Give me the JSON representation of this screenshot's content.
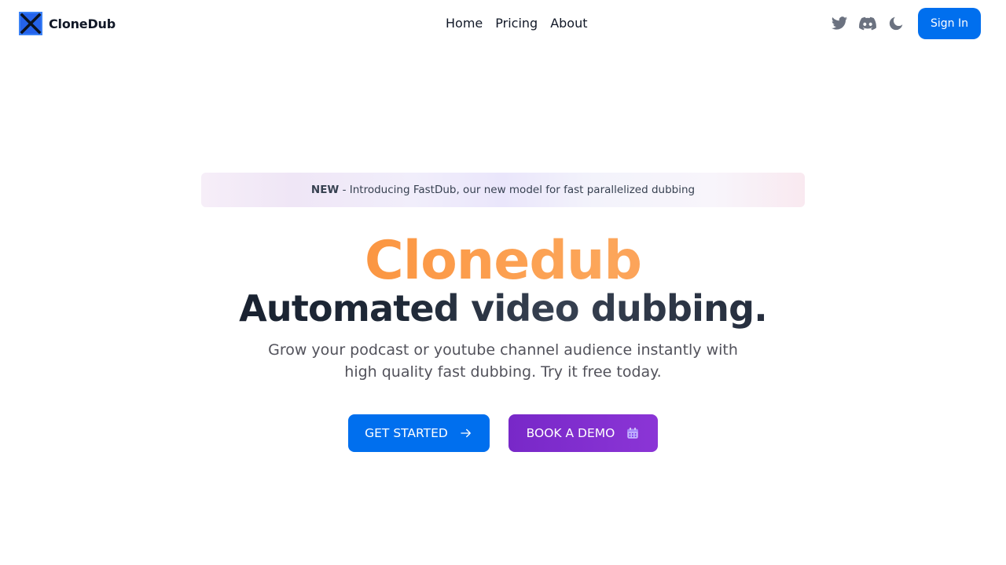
{
  "nav": {
    "brand": "CloneDub",
    "links": [
      "Home",
      "Pricing",
      "About"
    ],
    "icons": [
      "twitter-icon",
      "discord-icon",
      "moon-icon"
    ],
    "signin_label": "Sign In"
  },
  "banner": {
    "badge": "NEW",
    "text": " - Introducing FastDub, our new model for fast parallelized dubbing"
  },
  "hero": {
    "title": "Clonedub",
    "subtitle": "Automated video dubbing.",
    "description": "Grow your podcast or youtube channel audience instantly with high quality fast dubbing. Try it free today."
  },
  "cta": {
    "primary_label": "GET STARTED",
    "demo_label": "BOOK A DEMO"
  },
  "colors": {
    "primary": "#006fee",
    "demo": "#7828c8",
    "title_gradient_start": "#ff8a3d"
  }
}
